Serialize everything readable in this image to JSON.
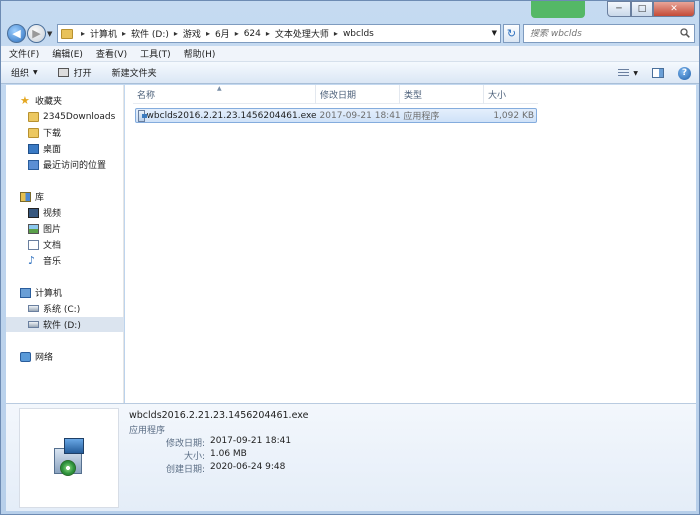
{
  "address": {
    "crumbs": [
      "计算机",
      "软件 (D:)",
      "游戏",
      "6月",
      "624",
      "文本处理大师",
      "wbclds"
    ]
  },
  "search": {
    "placeholder": "搜索 wbclds"
  },
  "window": {
    "min": "─",
    "max": "□",
    "close": "✕"
  },
  "menubar": {
    "items": [
      "文件(F)",
      "编辑(E)",
      "查看(V)",
      "工具(T)",
      "帮助(H)"
    ]
  },
  "toolbar": {
    "organize": "组织",
    "open": "打开",
    "new_folder": "新建文件夹",
    "help": "?"
  },
  "nav": {
    "favorites": "收藏夹",
    "fav_items": [
      "2345Downloads",
      "下载",
      "桌面",
      "最近访问的位置"
    ],
    "libraries": "库",
    "lib_items": [
      "视频",
      "图片",
      "文档",
      "音乐"
    ],
    "computer": "计算机",
    "drives": [
      "系统 (C:)",
      "软件 (D:)"
    ],
    "network": "网络"
  },
  "columns": {
    "name": "名称",
    "date": "修改日期",
    "type": "类型",
    "size": "大小"
  },
  "files": [
    {
      "name": "wbclds2016.2.21.23.1456204461.exe",
      "date": "2017-09-21 18:41",
      "type": "应用程序",
      "size": "1,092 KB"
    }
  ],
  "details": {
    "title": "wbclds2016.2.21.23.1456204461.exe",
    "type": "应用程序",
    "modified_label": "修改日期:",
    "modified_value": "2017-09-21 18:41",
    "size_label": "大小:",
    "size_value": "1.06 MB",
    "created_label": "创建日期:",
    "created_value": "2020-06-24 9:48"
  },
  "colors": {
    "selection": "#cfe2f8",
    "accent": "#2c6fbe",
    "close": "#c44a36"
  }
}
